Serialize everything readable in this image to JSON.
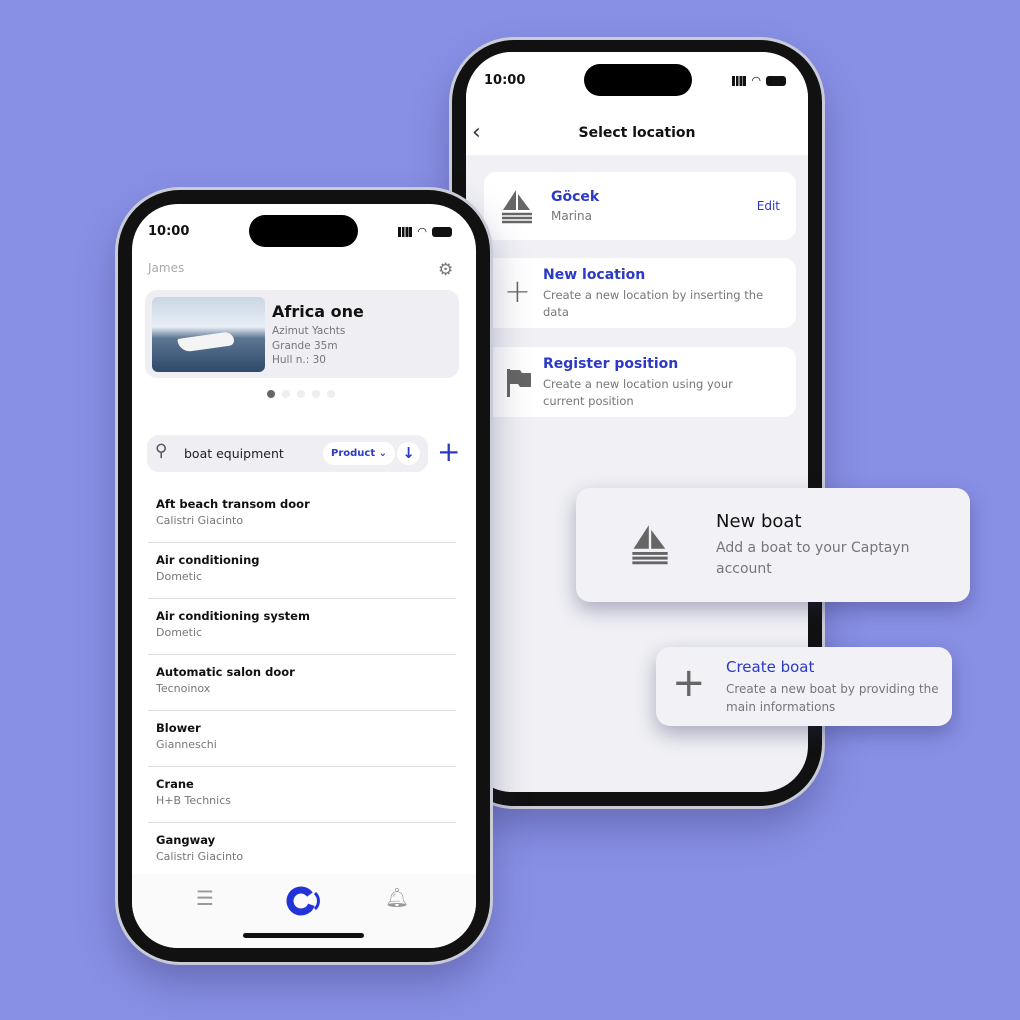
{
  "colors": {
    "background": "#8890e6",
    "accent": "#2b39c5",
    "icon_grey": "#666666"
  },
  "back_phone": {
    "status_time": "10:00",
    "header_title": "Select location",
    "back_icon": "chevron-left-icon",
    "current": {
      "name": "Göcek",
      "type": "Marina",
      "edit_label": "Edit",
      "icon": "sailboat-icon"
    },
    "options": [
      {
        "title": "New location",
        "desc": "Create a new location by inserting the data",
        "icon": "plus-icon"
      },
      {
        "title": "Register position",
        "desc": "Create a new location using your current position",
        "icon": "flag-icon"
      }
    ]
  },
  "front_phone": {
    "status_time": "10:00",
    "user_name": "James",
    "boat": {
      "name": "Africa one",
      "brand": "Azimut Yachts",
      "model": "Grande 35m",
      "hull": "Hull n.: 30"
    },
    "carousel": {
      "count": 5,
      "active": 0
    },
    "search": {
      "value": "boat equipment",
      "filter": "Product"
    },
    "items": [
      {
        "title": "Aft beach transom door",
        "subtitle": "Calistri Giacinto"
      },
      {
        "title": "Air conditioning",
        "subtitle": "Dometic"
      },
      {
        "title": "Air conditioning system",
        "subtitle": "Dometic"
      },
      {
        "title": "Automatic salon door",
        "subtitle": "Tecnoinox"
      },
      {
        "title": "Blower",
        "subtitle": "Gianneschi"
      },
      {
        "title": "Crane",
        "subtitle": "H+B Technics"
      },
      {
        "title": "Gangway",
        "subtitle": "Calistri Giacinto"
      }
    ]
  },
  "floating": {
    "new_boat": {
      "title": "New boat",
      "desc": "Add a boat to your Captayn account"
    },
    "create_boat": {
      "title": "Create boat",
      "desc": "Create a new boat by providing the main informations"
    }
  }
}
